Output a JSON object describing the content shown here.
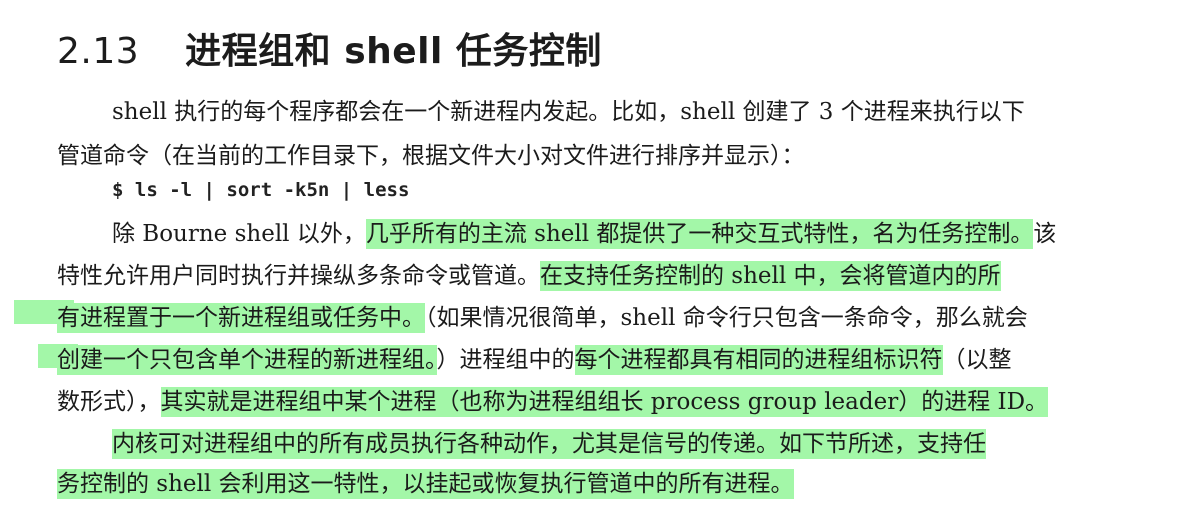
{
  "section": {
    "number": "2.13",
    "title": "进程组和 shell 任务控制"
  },
  "paragraph1": {
    "line1": "shell 执行的每个程序都会在一个新进程内发起。比如，shell 创建了 3 个进程来执行以下",
    "line2": "管道命令（在当前的工作目录下，根据文件大小对文件进行排序并显示）：",
    "command": "$ ls -l | sort -k5n | less"
  },
  "paragraph2": {
    "l1_plain_a": "除 Bourne shell 以外，",
    "l1_hl": "几乎所有的主流 shell 都提供了一种交互式特性，名为任务控制。",
    "l1_plain_b": "该",
    "l2_plain": "特性允许用户同时执行并操纵多条命令或管道。",
    "l2_hl": "在支持任务控制的 shell 中，会将管道内的所",
    "l3_hl": "有进程置于一个新进程组或任务中。",
    "l3_plain": "（如果情况很简单，shell 命令行只包含一条命令，那么就会",
    "l4_hl": "创建一个只包含单个进程的新进程组。",
    "l4_plain_a": "）进程组中的",
    "l4_hl2": "每个进程都具有相同的进程组标识符",
    "l4_plain_b": "（以整",
    "l5_plain_a": "数形式），",
    "l5_hl": "其实就是进程组中某个进程（也称为进程组组长 process group leader）的进程 ID。"
  },
  "paragraph3": {
    "l1_hl": "内核可对进程组中的所有成员执行各种动作，尤其是信号的传递。如下节所述，支持任",
    "l2_hl": "务控制的 shell 会利用这一特性，以挂起或恢复执行管道中的所有进程。"
  },
  "colors": {
    "highlight": "#a3f7a8",
    "text": "#1b1b1b"
  }
}
